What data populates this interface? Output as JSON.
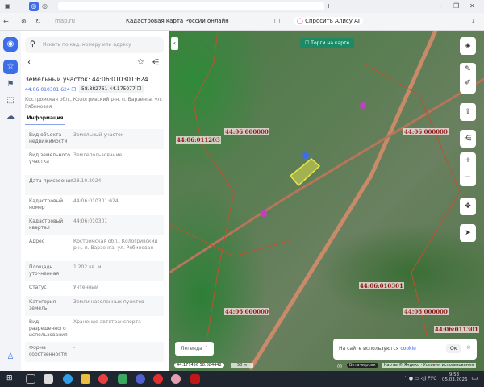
{
  "browser": {
    "url": "map.ru",
    "page_title": "Кадастровая карта России онлайн",
    "alice": "Спросить Алису AI"
  },
  "search": {
    "placeholder": "Искать по кад. номеру или адресу"
  },
  "parcel": {
    "title": "Земельный участок: 44:06:010301:624",
    "cad_link": "44:06:010301:624",
    "coords": "58.882761 44.175077",
    "address": "Костромская обл., Кологривский р-н, п. Варзенга, ул. Рябиновая",
    "tab": "Информация",
    "rows": [
      {
        "k": "Вид объекта недвижимости",
        "v": "Земельный участок"
      },
      {
        "k": "Вид земельного участка",
        "v": "Землепользование"
      },
      {
        "k": "Дата присвоения",
        "v": "28.10.2024"
      },
      {
        "k": "Кадастровый номер",
        "v": "44:06:010301:624"
      },
      {
        "k": "Кадастровый квартал",
        "v": "44:06:010301"
      },
      {
        "k": "Адрес",
        "v": "Костромская обл., Кологривский р-н, п. Варзенга, ул. Рябиновая"
      },
      {
        "k": "Площадь уточненная",
        "v": "1 202 кв. м"
      },
      {
        "k": "Статус",
        "v": "Учтенный"
      },
      {
        "k": "Категория земель",
        "v": "Земли населенных пунктов"
      },
      {
        "k": "Вид разрешенного использования",
        "v": "Хранение автотранспорта"
      },
      {
        "k": "Форма собственности",
        "v": "-"
      }
    ]
  },
  "map": {
    "auctions": "Торги на карте",
    "labels": [
      "44:06:011203",
      "44:06:000000",
      "44:06:000000",
      "44:06:010301",
      "44:06:000000",
      "44:06:000000",
      "44:06:011301"
    ],
    "legend": "Легенда",
    "cursor_coords": "44.177456 58.884442",
    "scale": "50 м",
    "beta": "Бета-версия",
    "copyright": "Карты © Яндекс · Условия использования",
    "cookie": {
      "text": "На сайте используются",
      "link": "cookie",
      "ok": "Ок"
    }
  },
  "taskbar": {
    "lang": "РУС",
    "time": "9:53",
    "date": "05.03.2026"
  },
  "colors": {
    "accent": "#3d6ee8",
    "parcel": "#e8e54a",
    "boundary": "#c2502f"
  }
}
